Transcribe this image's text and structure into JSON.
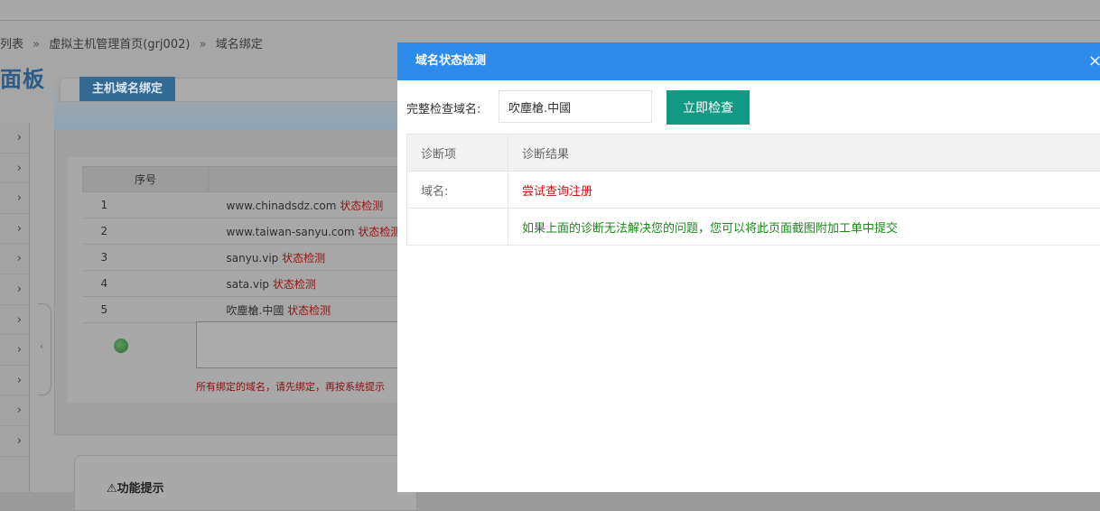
{
  "breadcrumb": {
    "items": [
      "列表",
      "虚拟主机管理首页(grj002)",
      "域名绑定"
    ],
    "separator": "»"
  },
  "panel_logo": "面板",
  "sidebar": {
    "chevron": "›",
    "rows": 11
  },
  "collapse_icon": "‹",
  "main": {
    "tab_label": "主机域名绑定",
    "table": {
      "headers": [
        "序号",
        ""
      ],
      "rows": [
        {
          "index": "1",
          "domain": "www.chinadsdz.com",
          "action": "状态检测"
        },
        {
          "index": "2",
          "domain": "www.taiwan-sanyu.com",
          "action": "状态检测"
        },
        {
          "index": "3",
          "domain": "sanyu.vip",
          "action": "状态检测"
        },
        {
          "index": "4",
          "domain": "sata.vip",
          "action": "状态检测"
        },
        {
          "index": "5",
          "domain": "吹塵槍.中國",
          "action": "状态检测"
        }
      ]
    },
    "hint": "所有绑定的域名，请先绑定，再按系统提示"
  },
  "func_tip": {
    "icon": "⚠",
    "title": "功能提示"
  },
  "modal": {
    "title": "域名状态检测",
    "close_icon": "×",
    "form": {
      "label": "完整检查域名:",
      "value": "吹塵槍.中國",
      "button": "立即检查"
    },
    "table": {
      "headers": [
        "诊断项",
        "诊断结果"
      ],
      "rows": [
        {
          "item": "域名:",
          "result": "尝试查询注册",
          "color": "#d01010"
        },
        {
          "item": "",
          "result": "如果上面的诊断无法解决您的问题，您可以将此页面截图附加工单中提交",
          "color": "#1b8a1b"
        }
      ]
    }
  },
  "colors": {
    "modal_header": "#2d8ceb",
    "check_button": "#139a84",
    "tab_bg": "#336a94"
  }
}
